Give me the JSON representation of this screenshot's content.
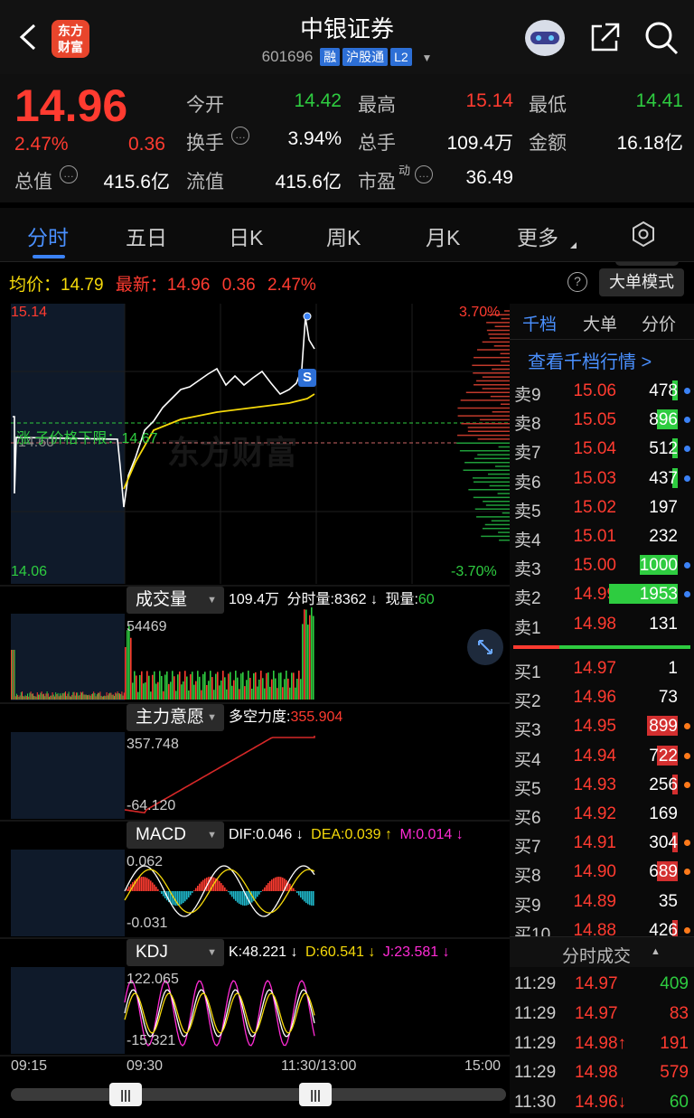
{
  "header": {
    "title": "中银证券",
    "code": "601696",
    "tags": [
      "融",
      "沪股通",
      "L2"
    ],
    "brand": "东方\n财富"
  },
  "quote": {
    "price": "14.96",
    "change_pct": "2.47%",
    "change_amt": "0.36",
    "items": [
      {
        "label": "今开",
        "value": "14.42",
        "color": "green"
      },
      {
        "label": "最高",
        "value": "15.14",
        "color": "red"
      },
      {
        "label": "最低",
        "value": "14.41",
        "color": "green"
      },
      {
        "label": "换手",
        "value": "3.94%",
        "color": "white"
      },
      {
        "label": "总手",
        "value": "109.4万",
        "color": "white"
      },
      {
        "label": "金额",
        "value": "16.18亿",
        "color": "white"
      },
      {
        "label": "总值",
        "value": "415.6亿",
        "color": "white"
      },
      {
        "label": "流值",
        "value": "415.6亿",
        "color": "white"
      },
      {
        "label": "市盈",
        "value": "36.49",
        "color": "white"
      }
    ],
    "more": "更多",
    "pe_sup": "动"
  },
  "tabs": [
    "分时",
    "五日",
    "日K",
    "周K",
    "月K",
    "更多"
  ],
  "info_line": {
    "avg_label": "均价：",
    "avg": "14.79",
    "latest_label": "最新：",
    "latest": "14.96",
    "chg": "0.36",
    "pct": "2.47%",
    "mode": "大单模式"
  },
  "main_chart": {
    "high": "15.14",
    "low": "14.06",
    "pct_high": "3.70%",
    "pct_low": "-3.70%",
    "prev_close": "14.60",
    "limit_label": "涨 子价格下限：14.67",
    "sell_marker": "S",
    "watermark": "东方财富"
  },
  "volume": {
    "button": "成交量",
    "total": "109.4万",
    "tick_label": "分时量:",
    "tick": "8362",
    "tick_arrow": "↓",
    "now_label": "现量:",
    "now": "60",
    "max": "54469"
  },
  "mainforce": {
    "button": "主力意愿",
    "label": "多空力度:",
    "value": "355.904",
    "top": "357.748",
    "bottom": "-64.120"
  },
  "macd": {
    "button": "MACD",
    "dif": "DIF:0.046 ↓",
    "dea": "DEA:0.039 ↑",
    "m": "M:0.014 ↓",
    "top": "0.062",
    "bottom": "-0.031"
  },
  "kdj": {
    "button": "KDJ",
    "k": "K:48.221 ↓",
    "d": "D:60.541 ↓",
    "j": "J:23.581 ↓",
    "top": "122.065",
    "bottom": "-15.321"
  },
  "time_axis": [
    "09:15",
    "09:30",
    "11:30/13:00",
    "15:00"
  ],
  "panel": {
    "tabs": [
      "千档",
      "大单",
      "分价"
    ],
    "link": "查看千档行情 >",
    "trades_title": "分时成交"
  },
  "asks": [
    {
      "label": "卖9",
      "price": "15.06",
      "vol": "478",
      "bar": 0.02
    },
    {
      "label": "卖8",
      "price": "15.05",
      "vol": "896",
      "bar": 0.3
    },
    {
      "label": "卖7",
      "price": "15.04",
      "vol": "512",
      "bar": 0.02
    },
    {
      "label": "卖6",
      "price": "15.03",
      "vol": "437",
      "bar": 0.02
    },
    {
      "label": "卖5",
      "price": "15.02",
      "vol": "197",
      "bar": 0.0
    },
    {
      "label": "卖4",
      "price": "15.01",
      "vol": "232",
      "bar": 0.0
    },
    {
      "label": "卖3",
      "price": "15.00",
      "vol": "1000",
      "bar": 0.55
    },
    {
      "label": "卖2",
      "price": "14.99",
      "vol": "1953",
      "bar": 1.0
    },
    {
      "label": "卖1",
      "price": "14.98",
      "vol": "131",
      "bar": 0.0
    }
  ],
  "bids": [
    {
      "label": "买1",
      "price": "14.97",
      "vol": "1",
      "bar": 0.0
    },
    {
      "label": "买2",
      "price": "14.96",
      "vol": "73",
      "bar": 0.0
    },
    {
      "label": "买3",
      "price": "14.95",
      "vol": "899",
      "bar": 0.45
    },
    {
      "label": "买4",
      "price": "14.94",
      "vol": "722",
      "bar": 0.3
    },
    {
      "label": "买5",
      "price": "14.93",
      "vol": "256",
      "bar": 0.02
    },
    {
      "label": "买6",
      "price": "14.92",
      "vol": "169",
      "bar": 0.0
    },
    {
      "label": "买7",
      "price": "14.91",
      "vol": "304",
      "bar": 0.02
    },
    {
      "label": "买8",
      "price": "14.90",
      "vol": "689",
      "bar": 0.3
    },
    {
      "label": "买9",
      "price": "14.89",
      "vol": "35",
      "bar": 0.0
    },
    {
      "label": "买10",
      "price": "14.88",
      "vol": "426",
      "bar": 0.02
    }
  ],
  "trades": [
    {
      "time": "11:29",
      "price": "14.97",
      "vol": "409",
      "vcolor": "#2ecc40"
    },
    {
      "time": "11:29",
      "price": "14.97",
      "vol": "83",
      "vcolor": "#ff3b30"
    },
    {
      "time": "11:29",
      "price": "14.98↑",
      "vol": "191",
      "vcolor": "#ff3b30"
    },
    {
      "time": "11:29",
      "price": "14.98",
      "vol": "579",
      "vcolor": "#ff3b30"
    },
    {
      "time": "11:30",
      "price": "14.96↓",
      "vol": "60",
      "vcolor": "#2ecc40"
    }
  ],
  "colors": {
    "up": "#ff3b30",
    "down": "#2ecc40",
    "avg": "#f5d90a",
    "accent": "#3b82f6"
  }
}
